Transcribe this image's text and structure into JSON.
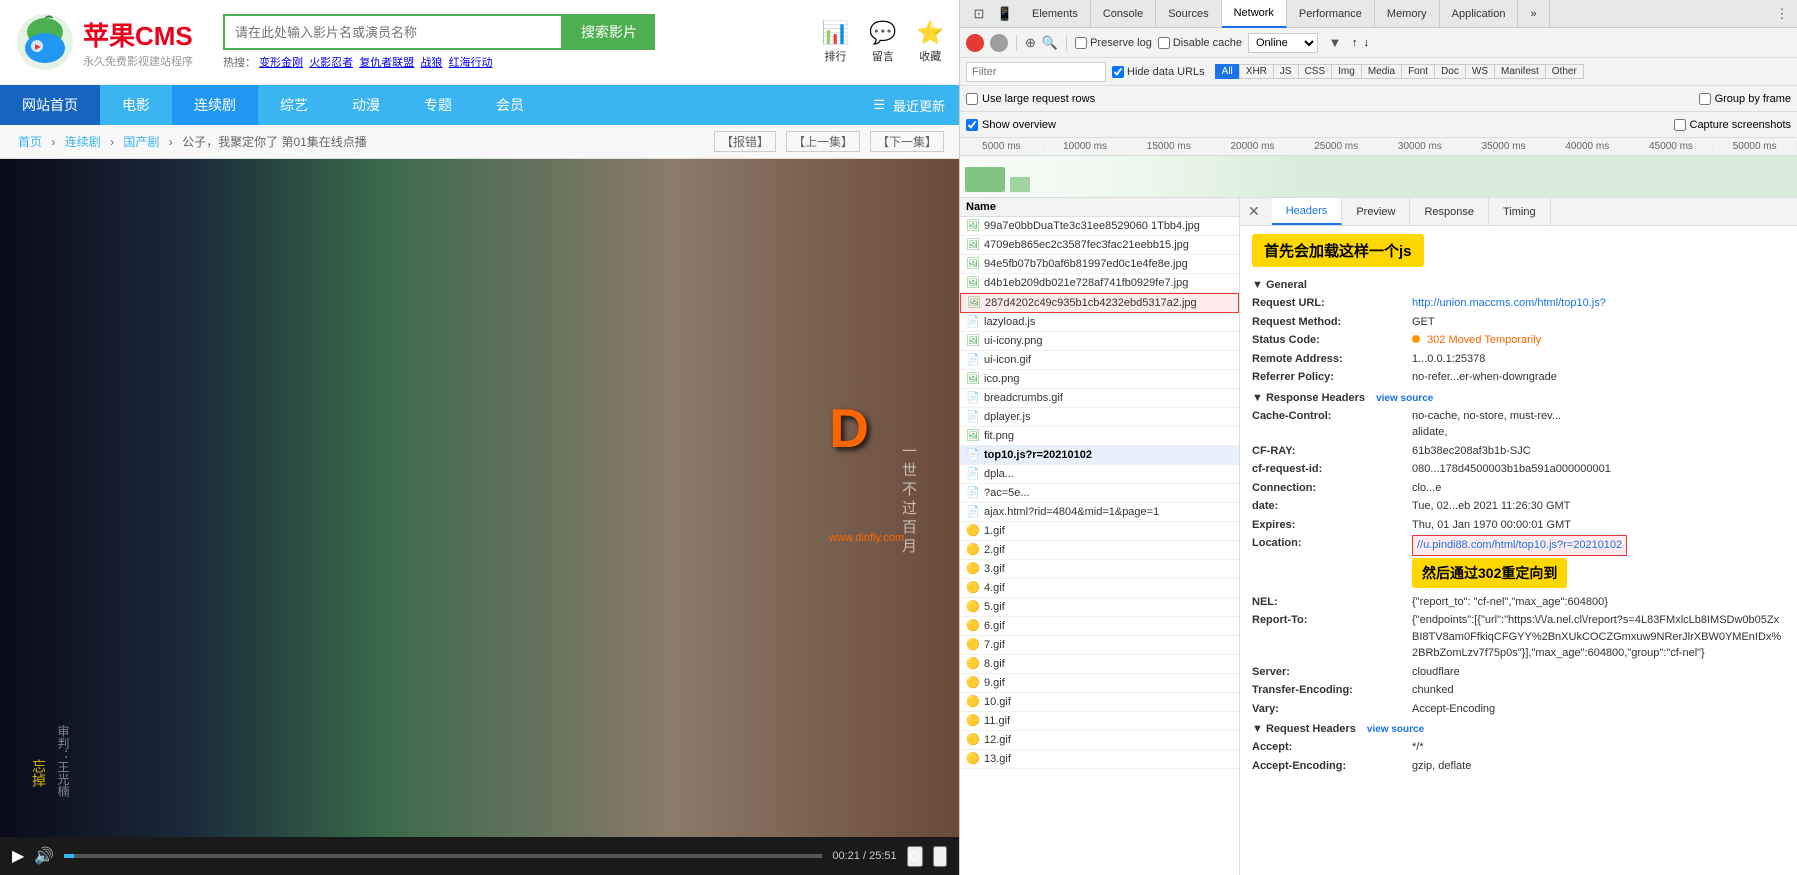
{
  "devtools": {
    "tabs": [
      "Elements",
      "Console",
      "Sources",
      "Network",
      "Performance",
      "Memory",
      "Application"
    ],
    "active_tab": "Network",
    "toolbar": {
      "record_label": "●",
      "stop_label": "⊘",
      "filter_label": "⊕",
      "search_label": "🔍",
      "preserve_log": "Preserve log",
      "disable_cache": "Disable cache",
      "online_label": "Online",
      "upload_label": "↑",
      "download_label": "↓"
    },
    "filter": {
      "placeholder": "Filter",
      "hide_data_urls": "Hide data URLs",
      "types": [
        "All",
        "XHR",
        "JS",
        "CSS",
        "Img",
        "Media",
        "Font",
        "Doc",
        "WS",
        "Manifest",
        "Other"
      ]
    },
    "options": {
      "use_large_rows": "Use large request rows",
      "group_by_frame": "Group by frame",
      "show_overview": "Show overview",
      "capture_screenshots": "Capture screenshots"
    },
    "timeline": {
      "marks": [
        "5000 ms",
        "10000 ms",
        "15000 ms",
        "20000 ms",
        "25000 ms",
        "30000 ms",
        "35000 ms",
        "40000 ms",
        "45000 ms",
        "50000 ms"
      ]
    }
  },
  "network": {
    "files": [
      {
        "name": "99a7e0bbDuaTte3c31ee8529060 1Tbb4.jpg",
        "type": "img"
      },
      {
        "name": "4709eb865ec2c3587fec3fac21eebb15.jpg",
        "type": "img"
      },
      {
        "name": "94e5fb07b7b0af6b81997ed0c1e4fe8e.jpg",
        "type": "img"
      },
      {
        "name": "d4b1eb209db021e728af741fb0929fe7.jpg",
        "type": "img"
      },
      {
        "name": "287d4202c49c935b1cb4232ebd5317a2.jpg",
        "type": "img",
        "highlighted": true
      },
      {
        "name": "lazyload.js",
        "type": "js"
      },
      {
        "name": "ui-icony.png",
        "type": "img"
      },
      {
        "name": "ui-icon.gif",
        "type": "gif"
      },
      {
        "name": "ico.png",
        "type": "img"
      },
      {
        "name": "breadcrumbs.gif",
        "type": "gif"
      },
      {
        "name": "dplayer.js",
        "type": "js"
      },
      {
        "name": "fit.png",
        "type": "img"
      },
      {
        "name": "top10.js?r=20210102",
        "type": "js",
        "selected": true
      },
      {
        "name": "dpla...",
        "type": "other"
      },
      {
        "name": "?ac=5e...",
        "type": "other"
      },
      {
        "name": "ajax.html?rid=4804&mid=1&page=1",
        "type": "other"
      },
      {
        "name": "1.gif",
        "type": "gif"
      },
      {
        "name": "2.gif",
        "type": "gif"
      },
      {
        "name": "3.gif",
        "type": "gif"
      },
      {
        "name": "4.gif",
        "type": "gif"
      },
      {
        "name": "5.gif",
        "type": "gif"
      },
      {
        "name": "6.gif",
        "type": "gif"
      },
      {
        "name": "7.gif",
        "type": "gif"
      },
      {
        "name": "8.gif",
        "type": "gif"
      },
      {
        "name": "9.gif",
        "type": "gif"
      },
      {
        "name": "10.gif",
        "type": "gif"
      },
      {
        "name": "11.gif",
        "type": "gif"
      },
      {
        "name": "12.gif",
        "type": "gif"
      },
      {
        "name": "13.gif",
        "type": "gif"
      }
    ],
    "detail_url": "http://union.maccms.com/html/top10.js?r=20210102",
    "details": {
      "selected_file": "top10.js?r=20210102",
      "tabs": [
        "Headers",
        "Preview",
        "Response",
        "Timing"
      ],
      "active_tab": "Headers",
      "general": {
        "title": "General",
        "request_url_label": "Request URL:",
        "request_url": "http://union.maccms.com/html/top10.js?",
        "method_label": "Request Method:",
        "method": "GET",
        "status_label": "Status Code:",
        "status": "302 Moved Temporarily",
        "remote_label": "Remote Address:",
        "remote": "1...0.0.1:25378",
        "referrer_label": "Referrer Policy:",
        "referrer": "no-refer..er-when-downgrade"
      },
      "response_headers": {
        "title": "Response Headers",
        "cache_control": "Cache-Control: no-cache, no-store, must-rev...\nalidate,",
        "cf_ray": "CF-RAY: 61b38ec208af3b1b-SJC",
        "cf_request_id": "cf-request-id: 080...178d4500003b1ba591a000000001",
        "connection": "Connection: clo...e",
        "date": "date: Tue, 02...eb 2021 11:26:30 GMT",
        "expires": "Expires: Thu, 01 Jan 1970 00:00:01 GMT",
        "location_label": "Location:",
        "location": "//u.pindi88.com/html/top10.js?r=20210102",
        "nel": "NEL: {\"report_to\": \"cf-nel\",\"max_age\":604800}",
        "report_to": "Report-To: {\"endpoints\":[{\"url\":\"https:\\/\\/a.nel.cl\\/report?s=4L83FMxlcLb8IMSDw0b05ZxBI8TV8am0FfkiqCFGYY%2BnXUkCOCZGmxuw9NRerJlrXBW0YMEnIDx%2BRbZomLzv7f75p0s\"}],\"max_age\":604800,\"group\":\"cf-nel\"}",
        "server": "Server: cloudflare",
        "transfer_encoding": "Transfer-Encoding: chunked",
        "vary": "Vary: Accept-Encoding"
      },
      "request_headers": {
        "title": "Request Headers",
        "accept": "Accept: */*",
        "accept_encoding": "Accept-Encoding: gzip, deflate"
      }
    }
  },
  "site": {
    "logo_text": "苹果CMS",
    "logo_sub": "永久免费影视建站程序",
    "search_placeholder": "请在此处输入影片名或演员名称",
    "search_btn": "搜索影片",
    "hot_label": "热搜：",
    "hot_items": [
      "变形金刚",
      "火影忍者",
      "复仇者联盟",
      "战狼",
      "红海行动"
    ],
    "nav_items": [
      "网站首页",
      "电影",
      "连续剧",
      "综艺",
      "动漫",
      "专题",
      "会员"
    ],
    "nav_right": "最近更新",
    "breadcrumb": "首页 > 连续剧 > 国产剧 > 公子，我聚定你了 第01集在线点播",
    "breadcrumb_actions": [
      "【报错】",
      "【上一集】",
      "【下一集】"
    ],
    "video_url": "www.dinfly.com",
    "video_time": "00:21 / 25:51",
    "video_text": "一世不过百月",
    "icons": {
      "rank": "📊",
      "message": "💬",
      "star": "⭐"
    }
  },
  "annotations": {
    "first_note": "首先会加载这样一个js",
    "second_note": "然后通过302重定向到"
  }
}
